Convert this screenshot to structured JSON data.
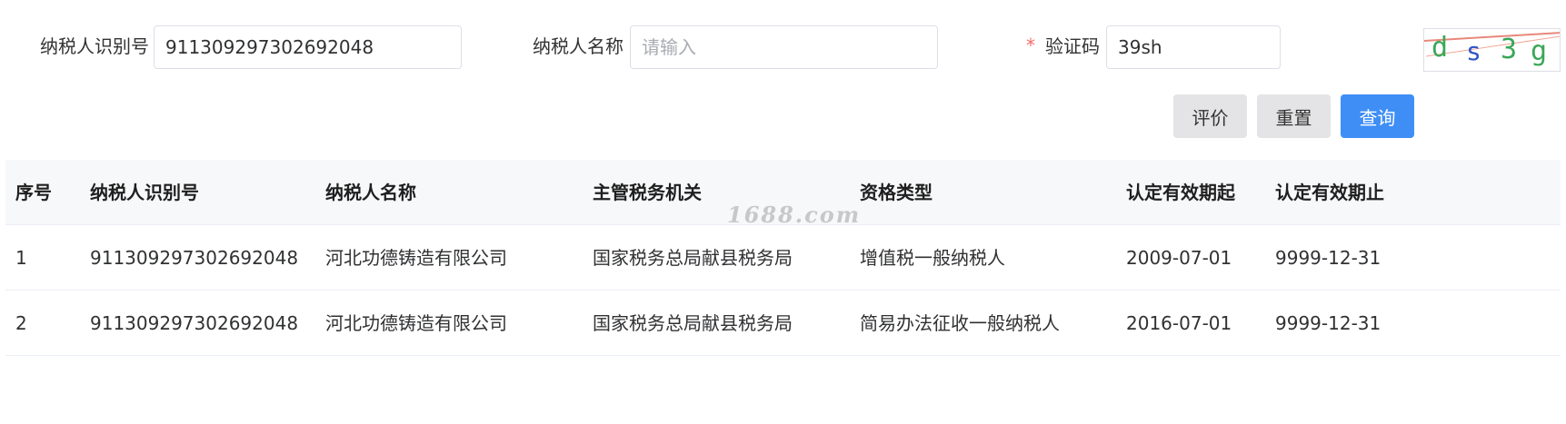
{
  "form": {
    "taxpayer_id_label": "纳税人识别号",
    "taxpayer_id_value": "911309297302692048",
    "taxpayer_name_label": "纳税人名称",
    "taxpayer_name_placeholder": "请输入",
    "captcha_required": "*",
    "captcha_label": "验证码",
    "captcha_value": "39sh",
    "captcha_image_text": "ds3g"
  },
  "buttons": {
    "evaluate": "评价",
    "reset": "重置",
    "query": "查询"
  },
  "table": {
    "headers": [
      "序号",
      "纳税人识别号",
      "纳税人名称",
      "主管税务机关",
      "资格类型",
      "认定有效期起",
      "认定有效期止"
    ],
    "rows": [
      [
        "1",
        "911309297302692048",
        "河北功德铸造有限公司",
        "国家税务总局献县税务局",
        "增值税一般纳税人",
        "2009-07-01",
        "9999-12-31"
      ],
      [
        "2",
        "911309297302692048",
        "河北功德铸造有限公司",
        "国家税务总局献县税务局",
        "简易办法征收一般纳税人",
        "2016-07-01",
        "9999-12-31"
      ]
    ]
  },
  "watermark": "1688.com",
  "colors": {
    "primary": "#3f8ef6",
    "required": "#f56c6c",
    "header_bg": "#f7f8fa"
  }
}
